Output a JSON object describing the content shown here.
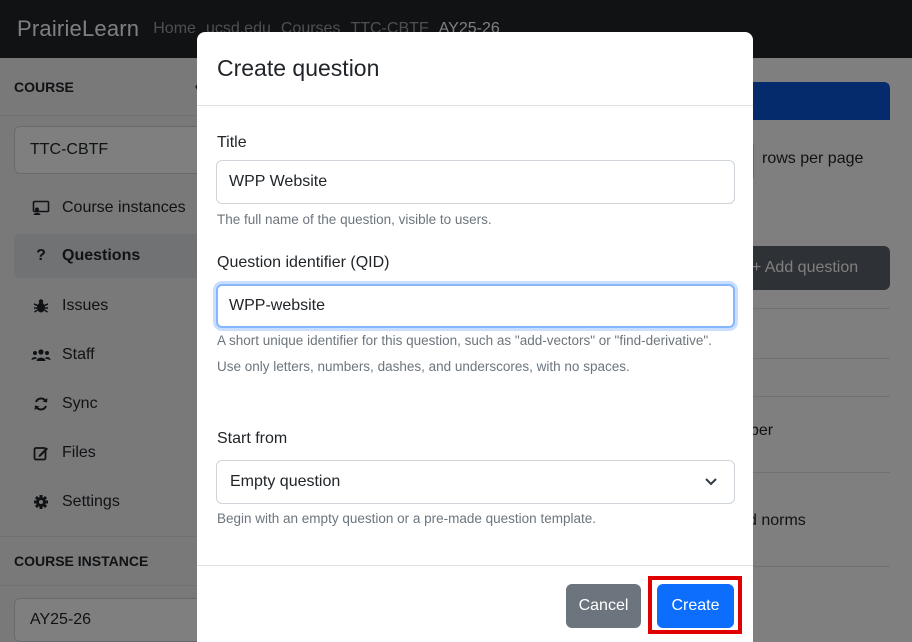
{
  "navbar": {
    "brand": "PrairieLearn",
    "breadcrumbs": [
      "Home",
      "ucsd.edu",
      "Courses",
      "TTC-CBTF",
      "AY25-26"
    ]
  },
  "sidebar": {
    "course_heading": "COURSE",
    "course_select": "TTC-CBTF",
    "items": [
      {
        "label": "Course instances",
        "icon": "chalkboard-icon"
      },
      {
        "label": "Questions",
        "icon": "question-mark-icon",
        "active": true
      },
      {
        "label": "Issues",
        "icon": "bug-icon"
      },
      {
        "label": "Staff",
        "icon": "users-icon"
      },
      {
        "label": "Sync",
        "icon": "sync-icon"
      },
      {
        "label": "Files",
        "icon": "edit-icon"
      },
      {
        "label": "Settings",
        "icon": "gear-icon"
      }
    ],
    "instance_heading": "COURSE INSTANCE",
    "instance_select": "AY25-26"
  },
  "main": {
    "rows_per_page_label": "rows per page",
    "add_question_label": "+ Add question",
    "partial_texts": [
      "ber",
      "d norms"
    ]
  },
  "modal": {
    "title": "Create question",
    "title_field": {
      "label": "Title",
      "value": "WPP Website",
      "help": "The full name of the question, visible to users."
    },
    "qid_field": {
      "label": "Question identifier (QID)",
      "value": "WPP-website",
      "help": "A short unique identifier for this question, such as \"add-vectors\" or \"find-derivative\". Use only letters, numbers, dashes, and underscores, with no spaces."
    },
    "start_from": {
      "label": "Start from",
      "selected": "Empty question",
      "help": "Begin with an empty question or a pre-made question template."
    },
    "cancel_label": "Cancel",
    "create_label": "Create"
  },
  "colors": {
    "navbar": "#212529",
    "primary": "#0d6efd",
    "secondary": "#6c757d",
    "highlight": "#e00000"
  }
}
